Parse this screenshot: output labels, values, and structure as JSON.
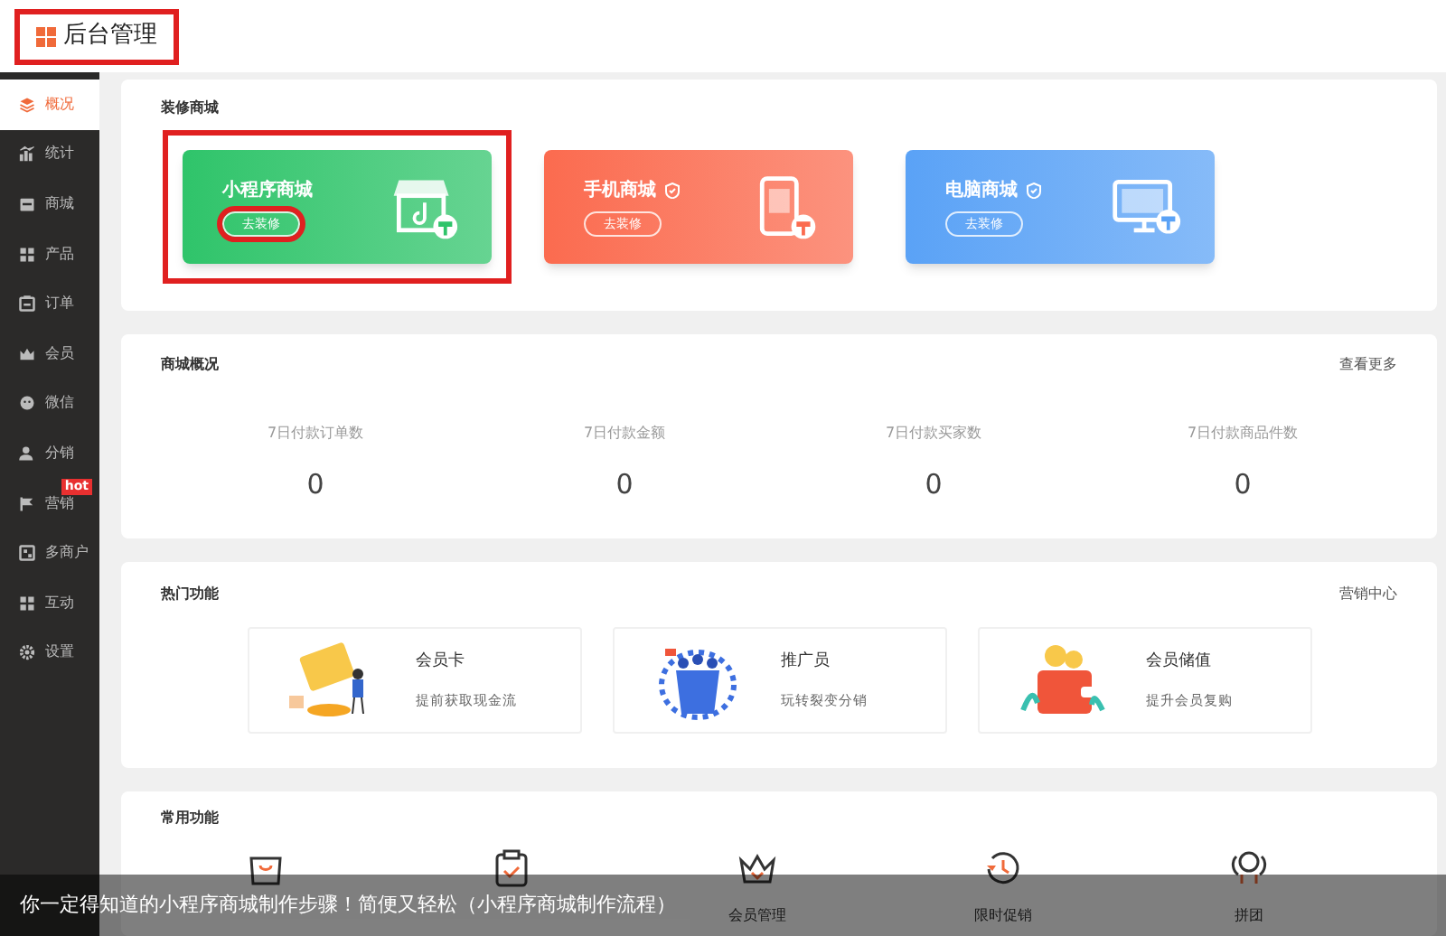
{
  "header": {
    "title": "后台管理",
    "highlighted": true
  },
  "sidebar": {
    "items": [
      {
        "label": "概况",
        "selected": true
      },
      {
        "label": "统计",
        "selected": false
      },
      {
        "label": "商城",
        "selected": false
      },
      {
        "label": "产品",
        "selected": false
      },
      {
        "label": "订单",
        "selected": false
      },
      {
        "label": "会员",
        "selected": false
      },
      {
        "label": "微信",
        "selected": false
      },
      {
        "label": "分销",
        "selected": false
      },
      {
        "label": "营销",
        "selected": false,
        "badge": "hot"
      },
      {
        "label": "多商户",
        "selected": false
      },
      {
        "label": "互动",
        "selected": false
      },
      {
        "label": "设置",
        "selected": false
      }
    ]
  },
  "decorate": {
    "title": "装修商城",
    "shops": [
      {
        "name": "小程序商城",
        "kind": "mini",
        "verified": false,
        "button": "去装修",
        "highlighted": true,
        "button_highlighted": true,
        "color": "#2fc46a"
      },
      {
        "name": "手机商城",
        "kind": "phone",
        "verified": true,
        "button": "去装修",
        "highlighted": false,
        "button_highlighted": false,
        "color": "#fb6b4f"
      },
      {
        "name": "电脑商城",
        "kind": "pc",
        "verified": true,
        "button": "去装修",
        "highlighted": false,
        "button_highlighted": false,
        "color": "#5aa2f6"
      }
    ]
  },
  "overview": {
    "title": "商城概况",
    "link": "查看更多",
    "stats": [
      {
        "label": "7日付款订单数",
        "value": "0"
      },
      {
        "label": "7日付款金额",
        "value": "0"
      },
      {
        "label": "7日付款买家数",
        "value": "0"
      },
      {
        "label": "7日付款商品件数",
        "value": "0"
      }
    ]
  },
  "hot": {
    "title": "热门功能",
    "link": "营销中心",
    "items": [
      {
        "kind": "vip",
        "name": "会员卡",
        "desc": "提前获取现金流"
      },
      {
        "kind": "promoter",
        "name": "推广员",
        "desc": "玩转裂变分销"
      },
      {
        "kind": "wallet",
        "name": "会员储值",
        "desc": "提升会员复购"
      }
    ]
  },
  "common": {
    "title": "常用功能",
    "items": [
      {
        "kind": "bag"
      },
      {
        "kind": "clipboard"
      },
      {
        "kind": "crown",
        "label": "会员管理"
      },
      {
        "kind": "clock",
        "label": "限时促销"
      },
      {
        "kind": "group",
        "label": "拼团"
      }
    ]
  },
  "caption": "你一定得知道的小程序商城制作步骤！简便又轻松（小程序商城制作流程）"
}
